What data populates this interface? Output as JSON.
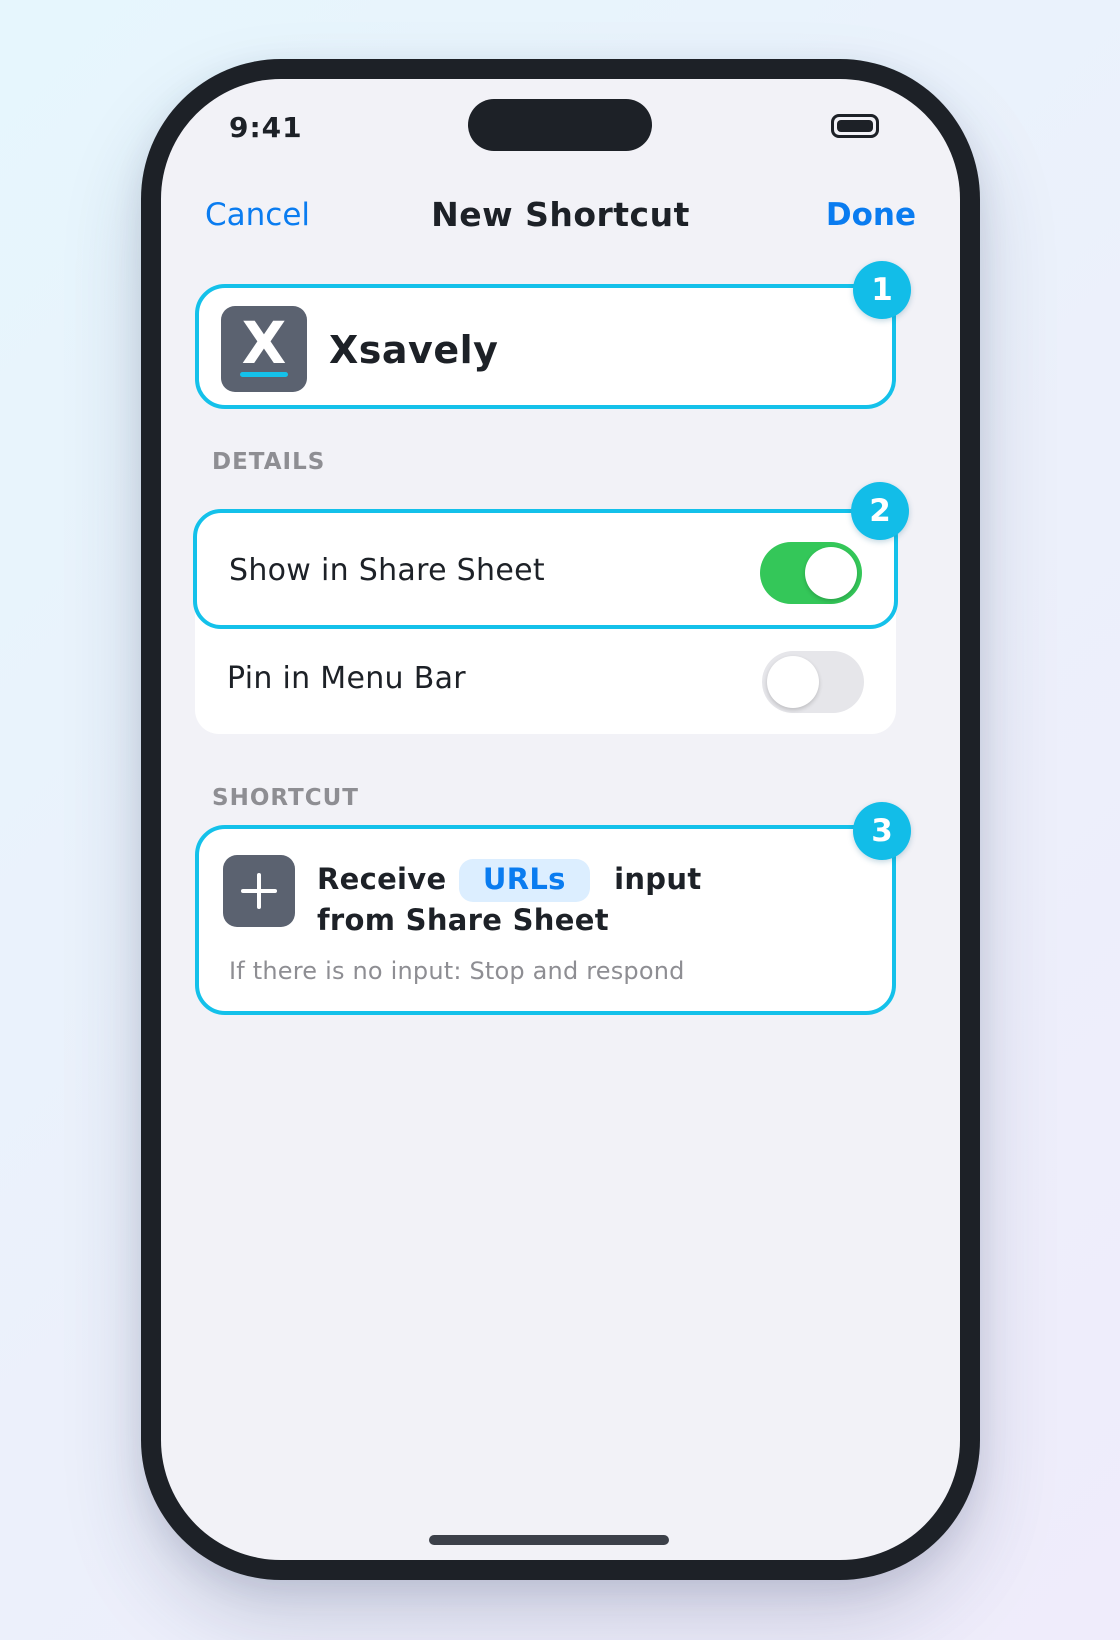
{
  "status_bar": {
    "time": "9:41"
  },
  "nav": {
    "cancel_label": "Cancel",
    "title": "New Shortcut",
    "done_label": "Done"
  },
  "app": {
    "icon_letter": "X",
    "name": "Xsavely",
    "badge": "1"
  },
  "details": {
    "header": "DETAILS",
    "badge": "2",
    "rows": [
      {
        "label": "Show in Share Sheet",
        "enabled": true
      },
      {
        "label": "Pin in Menu Bar",
        "enabled": false
      }
    ]
  },
  "shortcut": {
    "header": "SHORTCUT",
    "badge": "3",
    "action_prefix": "Receive",
    "input_token": "URLs",
    "action_suffix": "input",
    "action_line2": "from Share Sheet",
    "no_input_text": "If there is no input: Stop and respond"
  },
  "colors": {
    "accent_blue": "#0a7cf0",
    "highlight_cyan": "#14c1ea",
    "toggle_on": "#34c759",
    "toggle_off": "#e6e6ea",
    "icon_gray": "#5b6270"
  }
}
